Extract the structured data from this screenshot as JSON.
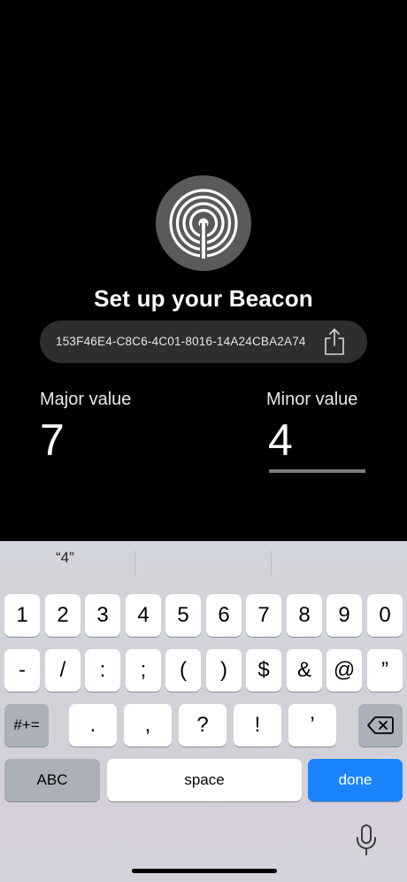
{
  "screen": {
    "title": "Set up your Beacon",
    "uuid": "153F46E4-C8C6-4C01-8016-14A24CBA2A74",
    "major_label": "Major value",
    "major_value": "7",
    "minor_label": "Minor value",
    "minor_value": "4"
  },
  "keyboard": {
    "suggestion": "“4”",
    "row1": [
      "1",
      "2",
      "3",
      "4",
      "5",
      "6",
      "7",
      "8",
      "9",
      "0"
    ],
    "row2": [
      "-",
      "/",
      ":",
      ";",
      "(",
      ")",
      "$",
      "&",
      "@",
      "”"
    ],
    "row3": [
      ".",
      ",",
      "?",
      "!",
      "’"
    ],
    "symbols_key": "#+=",
    "abc_key": "ABC",
    "space_key": "space",
    "done_key": "done"
  },
  "colors": {
    "background": "#000000",
    "pill": "#2e2e2e",
    "done_key": "#1a84ff",
    "keyboard": "#d2d5db"
  },
  "icons": {
    "beacon": "beacon-icon",
    "share": "share-icon",
    "backspace": "backspace-icon",
    "mic": "microphone-icon"
  }
}
